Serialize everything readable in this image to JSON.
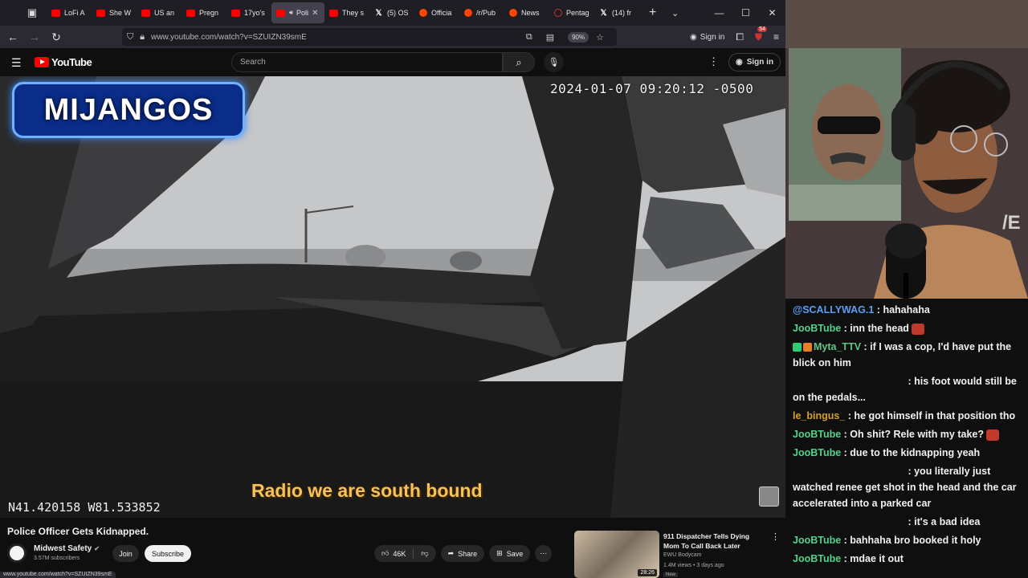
{
  "browser": {
    "tabs": [
      {
        "label": "LoFi A",
        "favicon": "youtube-icon"
      },
      {
        "label": "She W",
        "favicon": "youtube-icon"
      },
      {
        "label": "US an",
        "favicon": "youtube-icon"
      },
      {
        "label": "Pregn",
        "favicon": "youtube-icon"
      },
      {
        "label": "17yo's",
        "favicon": "youtube-icon"
      },
      {
        "label": "Poli",
        "favicon": "youtube-icon",
        "active": true
      },
      {
        "label": "They s",
        "favicon": "youtube-icon"
      },
      {
        "label": "(5) OS",
        "favicon": "x-icon"
      },
      {
        "label": "Officia",
        "favicon": "reddit-icon"
      },
      {
        "label": "/r/Pub",
        "favicon": "reddit-icon"
      },
      {
        "label": "News",
        "favicon": "reddit-icon"
      },
      {
        "label": "Pentag",
        "favicon": "pentagon-icon"
      },
      {
        "label": "(14) fr",
        "favicon": "x-icon"
      }
    ],
    "url": "www.youtube.com/watch?v=SZUIZN39smE",
    "zoom": "90%",
    "signin_label": "Sign in",
    "extension_badge": "54",
    "status_url": "www.youtube.com/watch?v=SZUIZN39smE"
  },
  "youtube": {
    "logo_text": "YouTube",
    "search_placeholder": "Search",
    "signin_label": "Sign in",
    "video": {
      "timestamp": "2024-01-07 09:20:12 -0500",
      "coords": "N41.420158 W81.533852",
      "subtitle": "Radio we are south bound",
      "name_plate": "MIJANGOS"
    },
    "title": "Police Officer Gets Kidnapped.",
    "channel": {
      "name": "Midwest Safety",
      "subs": "3.57M subscribers",
      "join": "Join",
      "subscribe": "Subscribe"
    },
    "actions": {
      "likes": "46K",
      "share": "Share",
      "save": "Save"
    },
    "recommended": {
      "title": "911 Dispatcher Tells Dying Mom To Call Back Later",
      "channel": "EWU Bodycam",
      "meta": "1.4M views • 3 days ago",
      "badge": "New",
      "duration": "28:26"
    }
  },
  "chat": [
    {
      "user": "@SCALLYWAG.1",
      "color": "scally",
      "text": "hahahaha"
    },
    {
      "user": "JooBTube",
      "color": "joob",
      "text": "inn the head",
      "emote": true
    },
    {
      "user": "Myta_TTV",
      "color": "myta",
      "text": "if I was a cop, I'd have put the blick on him",
      "badges": true
    },
    {
      "user": "",
      "color": "",
      "text": "his foot would still be on the pedals...",
      "indent": true
    },
    {
      "user": "le_bingus_",
      "color": "bingus",
      "text": "he got himself in that position tho"
    },
    {
      "user": "JooBTube",
      "color": "joob",
      "text": "Oh shit? Rele with my take?",
      "emote": true
    },
    {
      "user": "JooBTube",
      "color": "joob",
      "text": "due to the kidnapping yeah"
    },
    {
      "user": "",
      "color": "",
      "text": "you literally just watched renee get shot in the head and the car accelerated into a parked car",
      "indent": true
    },
    {
      "user": "",
      "color": "",
      "text": "it's a bad idea",
      "indent": true
    },
    {
      "user": "JooBTube",
      "color": "joob",
      "text": "bahhaha bro booked it holy"
    },
    {
      "user": "JooBTube",
      "color": "joob",
      "text": "mdae it out"
    }
  ]
}
